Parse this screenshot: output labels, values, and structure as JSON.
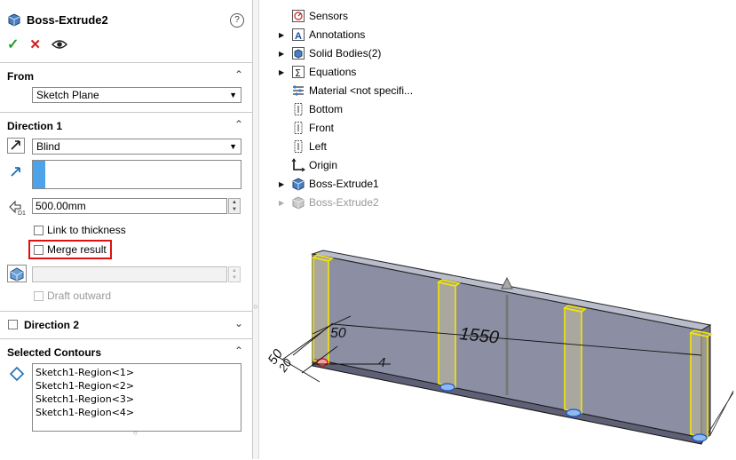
{
  "feature": {
    "title": "Boss-Extrude2",
    "help_glyph": "?",
    "ok_glyph": "✓",
    "cancel_glyph": "✕"
  },
  "from_section": {
    "header": "From",
    "value": "Sketch Plane"
  },
  "direction1": {
    "header": "Direction 1",
    "end_condition": "Blind",
    "depth": "500.00mm",
    "link_to_thickness": "Link to thickness",
    "merge_result": "Merge result",
    "draft_outward": "Draft outward"
  },
  "direction2": {
    "header": "Direction 2"
  },
  "selected_contours": {
    "header": "Selected Contours",
    "items": [
      "Sketch1-Region<1>",
      "Sketch1-Region<2>",
      "Sketch1-Region<3>",
      "Sketch1-Region<4>"
    ]
  },
  "tree": {
    "items": [
      {
        "label": "Sensors",
        "expandable": false,
        "icon": "sensor-icon"
      },
      {
        "label": "Annotations",
        "expandable": true,
        "icon": "annotation-icon"
      },
      {
        "label": "Solid Bodies(2)",
        "expandable": true,
        "icon": "solid-bodies-icon"
      },
      {
        "label": "Equations",
        "expandable": true,
        "icon": "equations-icon"
      },
      {
        "label": "Material <not specifi...",
        "expandable": false,
        "icon": "material-icon"
      },
      {
        "label": "Bottom",
        "expandable": false,
        "icon": "plane-icon"
      },
      {
        "label": "Front",
        "expandable": false,
        "icon": "plane-icon"
      },
      {
        "label": "Left",
        "expandable": false,
        "icon": "plane-icon"
      },
      {
        "label": "Origin",
        "expandable": false,
        "icon": "origin-icon"
      },
      {
        "label": "Boss-Extrude1",
        "expandable": true,
        "icon": "extrude-icon"
      },
      {
        "label": "Boss-Extrude2",
        "expandable": true,
        "icon": "extrude-icon",
        "greyed": true
      }
    ]
  },
  "viewport": {
    "dim_1550": "1550",
    "dim_50_a": "50",
    "dim_50_b": "50",
    "dim_4": "4",
    "dim_20": "20"
  }
}
